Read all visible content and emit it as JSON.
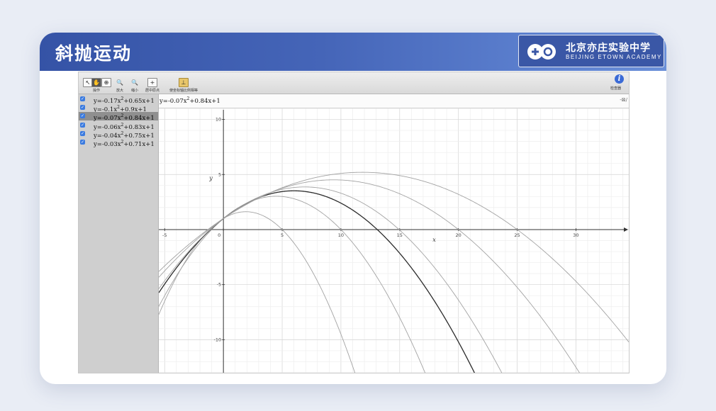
{
  "slide": {
    "title": "斜抛运动",
    "logo": {
      "chinese": "北京亦庄实验中学",
      "english": "BEIJING ETOWN ACADEMY"
    }
  },
  "toolbar": {
    "tools": [
      {
        "icon": "pointer-icon",
        "glyph": "↖",
        "label": ""
      },
      {
        "icon": "hand-icon",
        "glyph": "✋",
        "label": "操作"
      },
      {
        "icon": "zoom-box-icon",
        "glyph": "⊕",
        "label": ""
      },
      {
        "icon": "zoom-in-icon",
        "glyph": "🔍",
        "label": "放大"
      },
      {
        "icon": "zoom-out-icon",
        "glyph": "🔍",
        "label": "缩小"
      },
      {
        "icon": "center-origin-icon",
        "glyph": "+",
        "label": "居中原点"
      },
      {
        "icon": "axis-ratio-icon",
        "glyph": "⊥",
        "label": "使坐标轴比例相等"
      }
    ],
    "info_label": "检查器"
  },
  "sidebar": {
    "functions": [
      {
        "a": "-0.17",
        "b": "0.65",
        "c": "1",
        "checked": true,
        "selected": false
      },
      {
        "a": "-0.1",
        "b": "0.9",
        "c": "1",
        "checked": true,
        "selected": false
      },
      {
        "a": "-0.07",
        "b": "0.84",
        "c": "1",
        "checked": true,
        "selected": true
      },
      {
        "a": "-0.06",
        "b": "0.83",
        "c": "1",
        "checked": true,
        "selected": false
      },
      {
        "a": "-0.04",
        "b": "0.75",
        "c": "1",
        "checked": true,
        "selected": false
      },
      {
        "a": "-0.03",
        "b": "0.71",
        "c": "1",
        "checked": true,
        "selected": false
      }
    ]
  },
  "input_bar": {
    "a": "-0.07",
    "b": "0.84",
    "c": "1",
    "right_text": "-⊠∕"
  },
  "chart_data": {
    "type": "line",
    "xlabel": "x",
    "ylabel": "y",
    "xlim": [
      -5.5,
      34.5
    ],
    "ylim": [
      -13,
      11
    ],
    "x_ticks": [
      -5,
      0,
      5,
      10,
      15,
      20,
      25,
      30
    ],
    "y_ticks": [
      -10,
      -5,
      5,
      10
    ],
    "grid": true,
    "highlight_series": 2,
    "series": [
      {
        "name": "y=-0.17x^2+0.65x+1",
        "a": -0.17,
        "b": 0.65,
        "c": 1
      },
      {
        "name": "y=-0.1x^2+0.9x+1",
        "a": -0.1,
        "b": 0.9,
        "c": 1
      },
      {
        "name": "y=-0.07x^2+0.84x+1",
        "a": -0.07,
        "b": 0.84,
        "c": 1
      },
      {
        "name": "y=-0.06x^2+0.83x+1",
        "a": -0.06,
        "b": 0.83,
        "c": 1
      },
      {
        "name": "y=-0.04x^2+0.75x+1",
        "a": -0.04,
        "b": 0.75,
        "c": 1
      },
      {
        "name": "y=-0.03x^2+0.71x+1",
        "a": -0.03,
        "b": 0.71,
        "c": 1
      }
    ]
  }
}
